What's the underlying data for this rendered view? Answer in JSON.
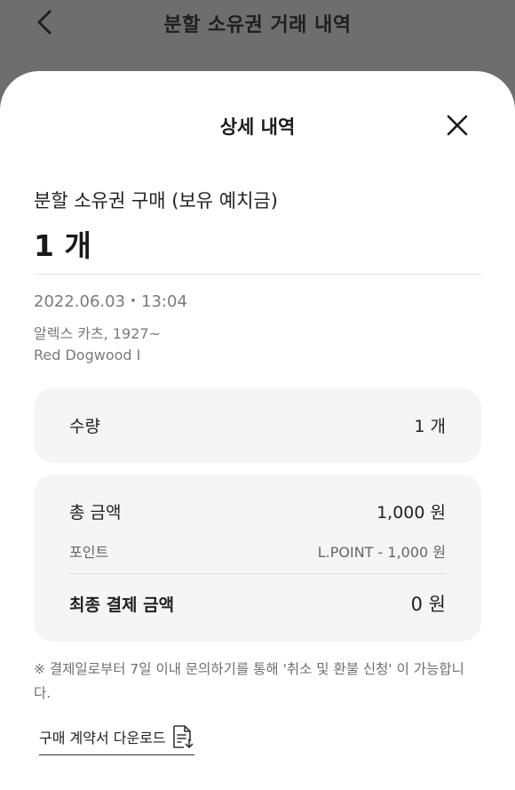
{
  "background": {
    "title": "분할 소유권 거래 내역"
  },
  "sheet": {
    "title": "상세 내역",
    "summary": {
      "label": "분할 소유권 구매 (보유 예치금)",
      "quantity": "1 개"
    },
    "meta": {
      "datetime": "2022.06.03・13:04",
      "artist_line": "알렉스 카츠, 1927~",
      "artwork_title": "Red Dogwood I"
    },
    "quantity_card": {
      "label": "수량",
      "value": "1 개"
    },
    "amount_card": {
      "total_label": "총 금액",
      "total_value": "1,000 원",
      "point_label": "포인트",
      "point_value": "L.POINT - 1,000 원",
      "final_label": "최종 결제 금액",
      "final_value": "0 원"
    },
    "notice": "※ 결제일로부터 7일 이내 문의하기를 통해 '취소 및 환불 신청' 이 가능합니다.",
    "download_label": "구매 계약서 다운로드"
  },
  "icons": {
    "back": "chevron-left-icon",
    "close": "close-icon",
    "download": "document-download-icon"
  },
  "colors": {
    "overlay": "#6e6e6e",
    "sheet": "#ffffff",
    "card": "#f5f5f5",
    "muted_text": "#7a7a7a"
  }
}
